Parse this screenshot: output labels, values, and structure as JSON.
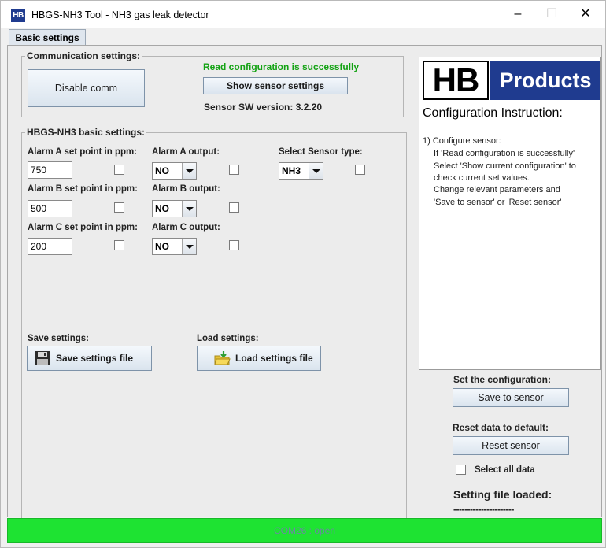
{
  "window": {
    "icon_text": "HB",
    "title": "HBGS-NH3 Tool - NH3 gas leak detector",
    "minimize": "–",
    "maximize": "☐",
    "close": "✕"
  },
  "tabs": [
    {
      "label": "Basic settings",
      "active": true
    }
  ],
  "communication": {
    "title": "Communication settings:",
    "disable_button": "Disable comm",
    "status": "Read configuration is successfully",
    "show_button": "Show sensor settings",
    "sw_version": "Sensor SW version: 3.2.20"
  },
  "basic": {
    "title": "HBGS-NH3 basic settings:",
    "alarm_a_label": "Alarm A set point in ppm:",
    "alarm_a_value": "750",
    "alarm_a_output_label": "Alarm A output:",
    "alarm_a_output": "NO",
    "sensor_type_label": "Select Sensor type:",
    "sensor_type": "NH3",
    "alarm_b_label": "Alarm B set point in ppm:",
    "alarm_b_value": "500",
    "alarm_b_output_label": "Alarm B output:",
    "alarm_b_output": "NO",
    "alarm_c_label": "Alarm C set point in ppm:",
    "alarm_c_value": "200",
    "alarm_c_output_label": "Alarm C output:",
    "alarm_c_output": "NO",
    "save_label": "Save settings:",
    "save_button": "Save settings file",
    "load_label": "Load settings:",
    "load_button": "Load settings file"
  },
  "instructions": {
    "logo_hb": "HB",
    "logo_products": "Products",
    "title": "Configuration Instruction:",
    "lines": [
      "1) Configure sensor:",
      "If 'Read configuration is successfully'",
      "Select 'Show current configuration' to",
      "check current set values.",
      "Change relevant parameters and",
      "'Save to sensor' or 'Reset sensor'"
    ]
  },
  "actions": {
    "set_config_label": "Set the configuration:",
    "save_to_sensor": "Save to sensor",
    "reset_label": "Reset data to default:",
    "reset_sensor": "Reset sensor",
    "select_all_label": "Select all data",
    "setting_file_loaded": "Setting file loaded:",
    "file_placeholder": "----------------------"
  },
  "status_bar": {
    "text": "COM26 : open",
    "color": "#1ee332"
  }
}
